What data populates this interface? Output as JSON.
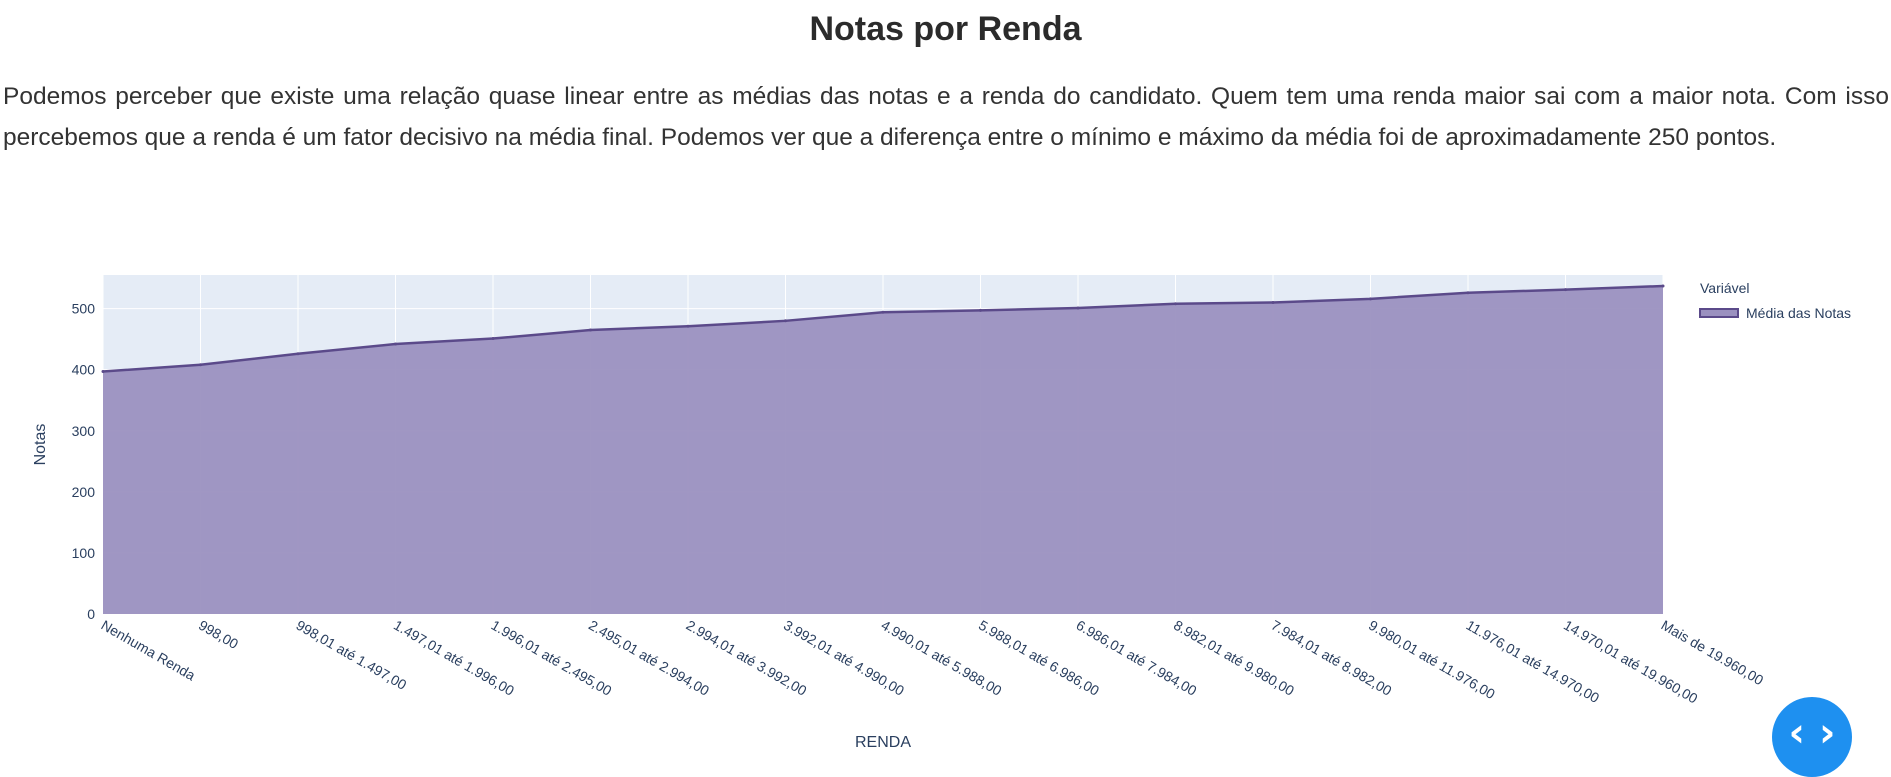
{
  "page": {
    "title": "Notas por Renda",
    "intro": "Podemos perceber que existe uma relação quase linear entre as médias das notas e a renda do candidato. Quem tem uma renda maior sai com a maior nota. Com isso percebemos que a renda é um fator decisivo na média final. Podemos ver que a diferença entre o mínimo e máximo da média foi de aproximadamente 250 pontos."
  },
  "nav_button": {
    "icon": "code-icon",
    "glyph": "‹ ›"
  },
  "colors": {
    "plot_bg": "#e5ecf6",
    "grid": "#ffffff",
    "area_fill": "#9b91c0",
    "line": "#5b4a8a",
    "text": "#2a3f5f",
    "fab": "#1e90f0"
  },
  "chart_data": {
    "type": "area",
    "xlabel": "RENDA",
    "ylabel": "Notas",
    "ylim": [
      0,
      555
    ],
    "yticks": [
      0,
      100,
      200,
      300,
      400,
      500
    ],
    "grid": true,
    "legend": {
      "title": "Variável",
      "position": "top-right"
    },
    "categories": [
      "Nenhuma Renda",
      "998,00",
      "998,01 até 1.497,00",
      "1.497,01 até 1.996,00",
      "1.996,01 até 2.495,00",
      "2.495,01 até 2.994,00",
      "2.994,01 até 3.992,00",
      "3.992,01 até 4.990,00",
      "4.990,01 até 5.988,00",
      "5.988,01 até 6.986,00",
      "6.986,01 até 7.984,00",
      "8.982,01 até 9.980,00",
      "7.984,01 até 8.982,00",
      "9.980,01 até 11.976,00",
      "11.976,01 até 14.970,00",
      "14.970,01 até 19.960,00",
      "Mais de 19.960,00"
    ],
    "series": [
      {
        "name": "Média das Notas",
        "values": [
          397,
          408,
          426,
          442,
          451,
          465,
          471,
          480,
          494,
          497,
          501,
          508,
          510,
          516,
          526,
          531,
          537
        ]
      }
    ]
  }
}
